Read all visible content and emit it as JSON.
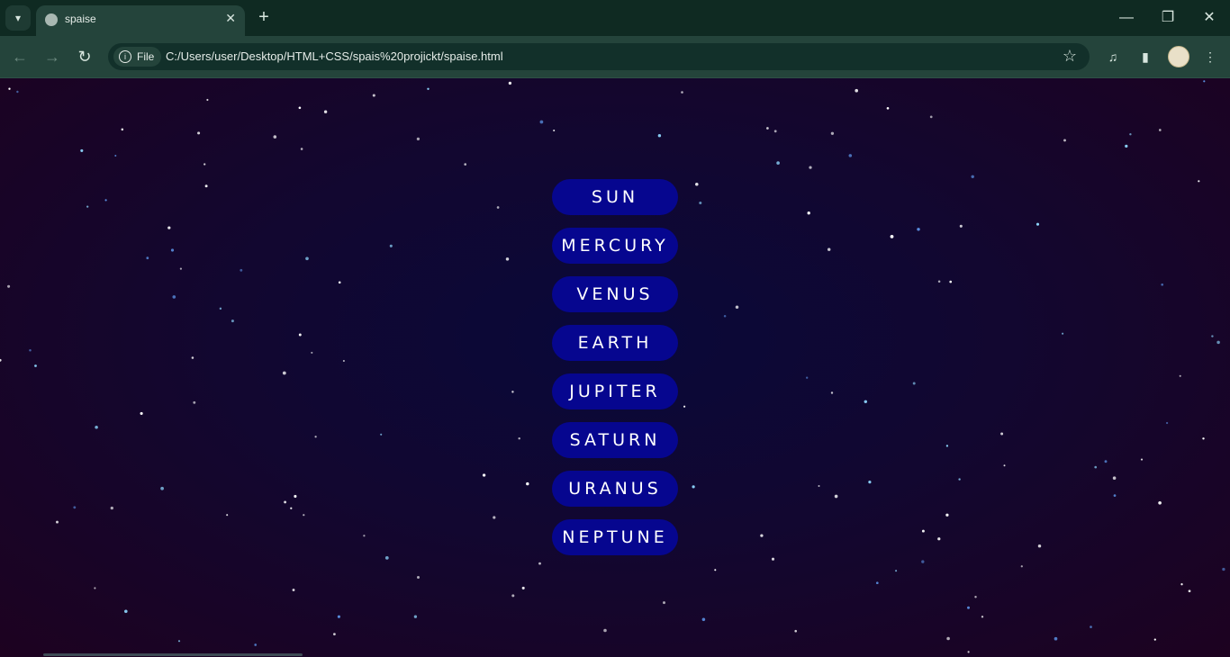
{
  "browser": {
    "tab_title": "spaise",
    "address": {
      "security_chip": "File",
      "url": "C:/Users/user/Desktop/HTML+CSS/spais%20projickt/spaise.html"
    }
  },
  "page": {
    "planets": [
      "SUN",
      "MERCURY",
      "VENUS",
      "EARTH",
      "JUPITER",
      "SATURN",
      "URANUS",
      "NEPTUNE"
    ],
    "colors": {
      "button_bg": "#06068f",
      "button_text": "#ffffff",
      "background_center": "#090839",
      "background_edge": "#1d0220",
      "star": "#8fd8ff"
    }
  }
}
